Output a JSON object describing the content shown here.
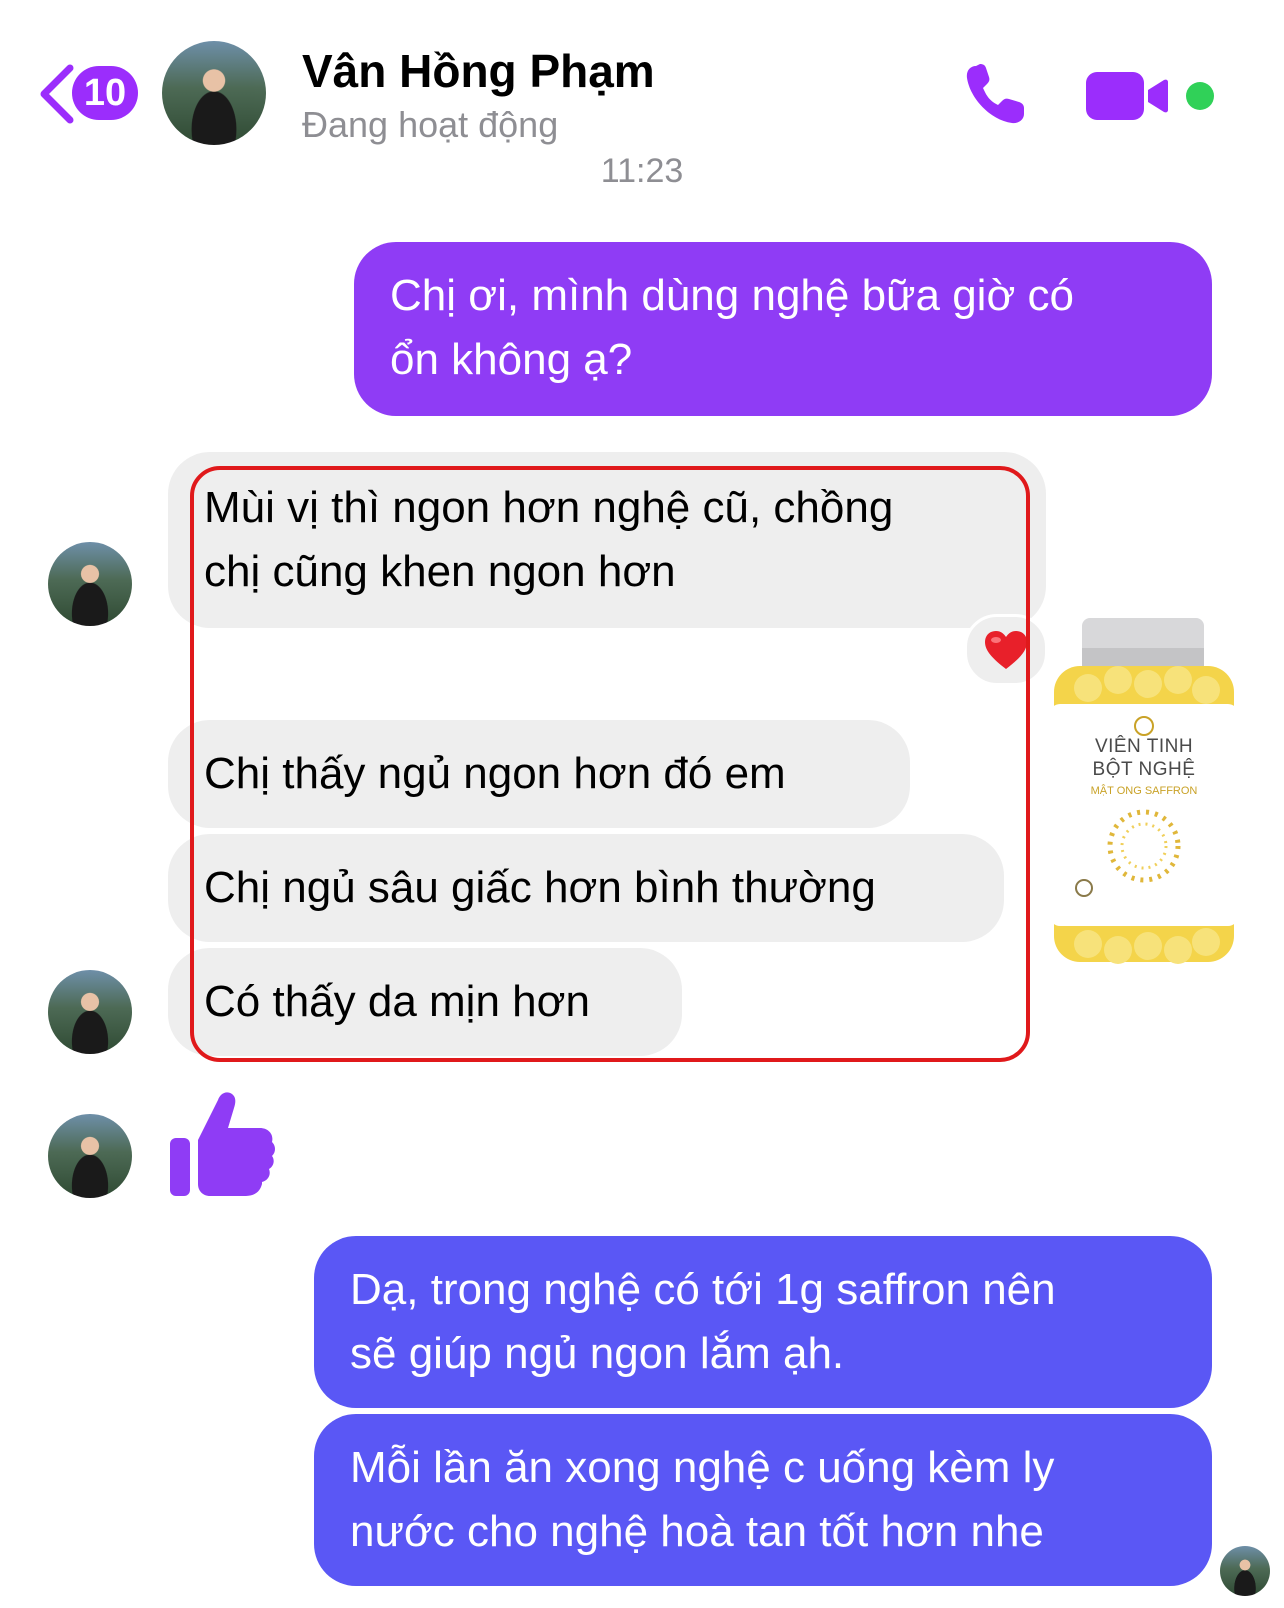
{
  "header": {
    "unread_count": "10",
    "contact_name": "Vân Hồng Phạm",
    "status": "Đang hoạt động"
  },
  "timestamp": "11:23",
  "messages": {
    "outgoing_1": {
      "line1": "Chị ơi, mình dùng nghệ bữa giờ có",
      "line2": "ổn không ạ?"
    },
    "incoming_1": {
      "line1": "Mùi vị thì ngon hơn nghệ cũ, chồng",
      "line2": "chị cũng khen ngon hơn"
    },
    "incoming_2": "Chị thấy ngủ ngon hơn đó em",
    "incoming_3": "Chị ngủ sâu giấc hơn bình thường",
    "incoming_4": "Có thấy da mịn hơn",
    "outgoing_2": {
      "line1": "Dạ, trong nghệ có tới 1g saffron nên",
      "line2": "sẽ giúp ngủ ngon lắm ạh."
    },
    "outgoing_3": {
      "line1": "Mỗi lần ăn xong nghệ c uống kèm ly",
      "line2": "nước cho nghệ hoà tan tốt hơn nhe"
    }
  },
  "reactions": {
    "incoming_1": "heart-icon"
  },
  "product": {
    "label_line1": "VIÊN TINH",
    "label_line2": "BỘT NGHỆ",
    "label_line3": "MẬT ONG SAFFRON"
  },
  "colors": {
    "accent_purple": "#8f3cf5",
    "accent_blue": "#5a57f5",
    "incoming_bubble": "#eeeeee",
    "online": "#30d158",
    "highlight": "#e0191b"
  }
}
